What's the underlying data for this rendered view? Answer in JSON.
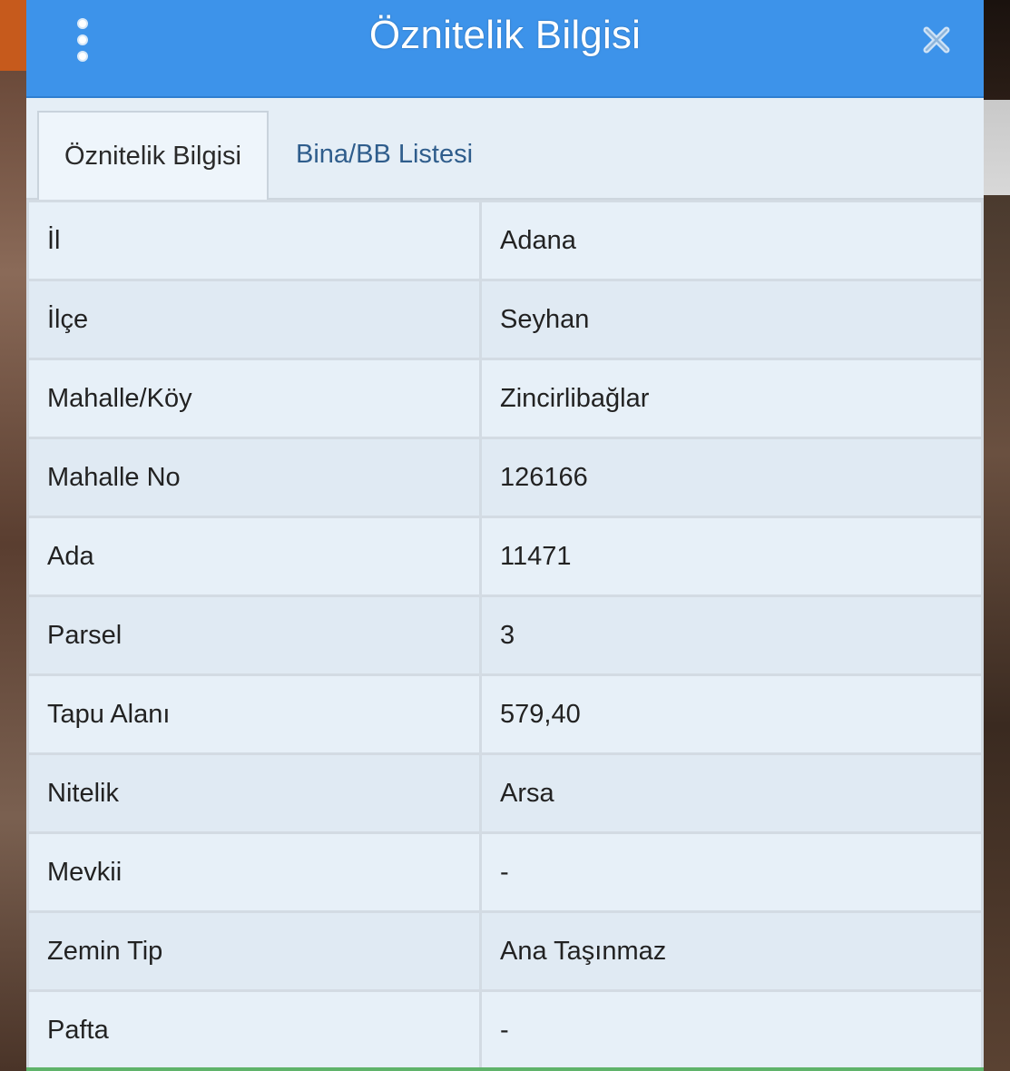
{
  "window": {
    "title": "Öznitelik Bilgisi"
  },
  "icons": {
    "menu": "vertical-dots-icon",
    "close": "close-x-icon"
  },
  "tabs": [
    {
      "label": "Öznitelik Bilgisi",
      "active": true
    },
    {
      "label": "Bina/BB Listesi",
      "active": false
    }
  ],
  "rows": [
    {
      "key": "İl",
      "value": "Adana"
    },
    {
      "key": "İlçe",
      "value": "Seyhan"
    },
    {
      "key": "Mahalle/Köy",
      "value": "Zincirlibağlar"
    },
    {
      "key": "Mahalle No",
      "value": "126166"
    },
    {
      "key": "Ada",
      "value": "11471"
    },
    {
      "key": "Parsel",
      "value": "3"
    },
    {
      "key": "Tapu Alanı",
      "value": "579,40"
    },
    {
      "key": "Nitelik",
      "value": "Arsa"
    },
    {
      "key": "Mevkii",
      "value": "-"
    },
    {
      "key": "Zemin Tip",
      "value": "Ana Taşınmaz"
    },
    {
      "key": "Pafta",
      "value": "-"
    }
  ],
  "colors": {
    "titlebar": "#3d93ea",
    "panel": "#e3edf5",
    "tab_link": "#2f5d8c",
    "bottom_accent": "#5fb36a"
  }
}
